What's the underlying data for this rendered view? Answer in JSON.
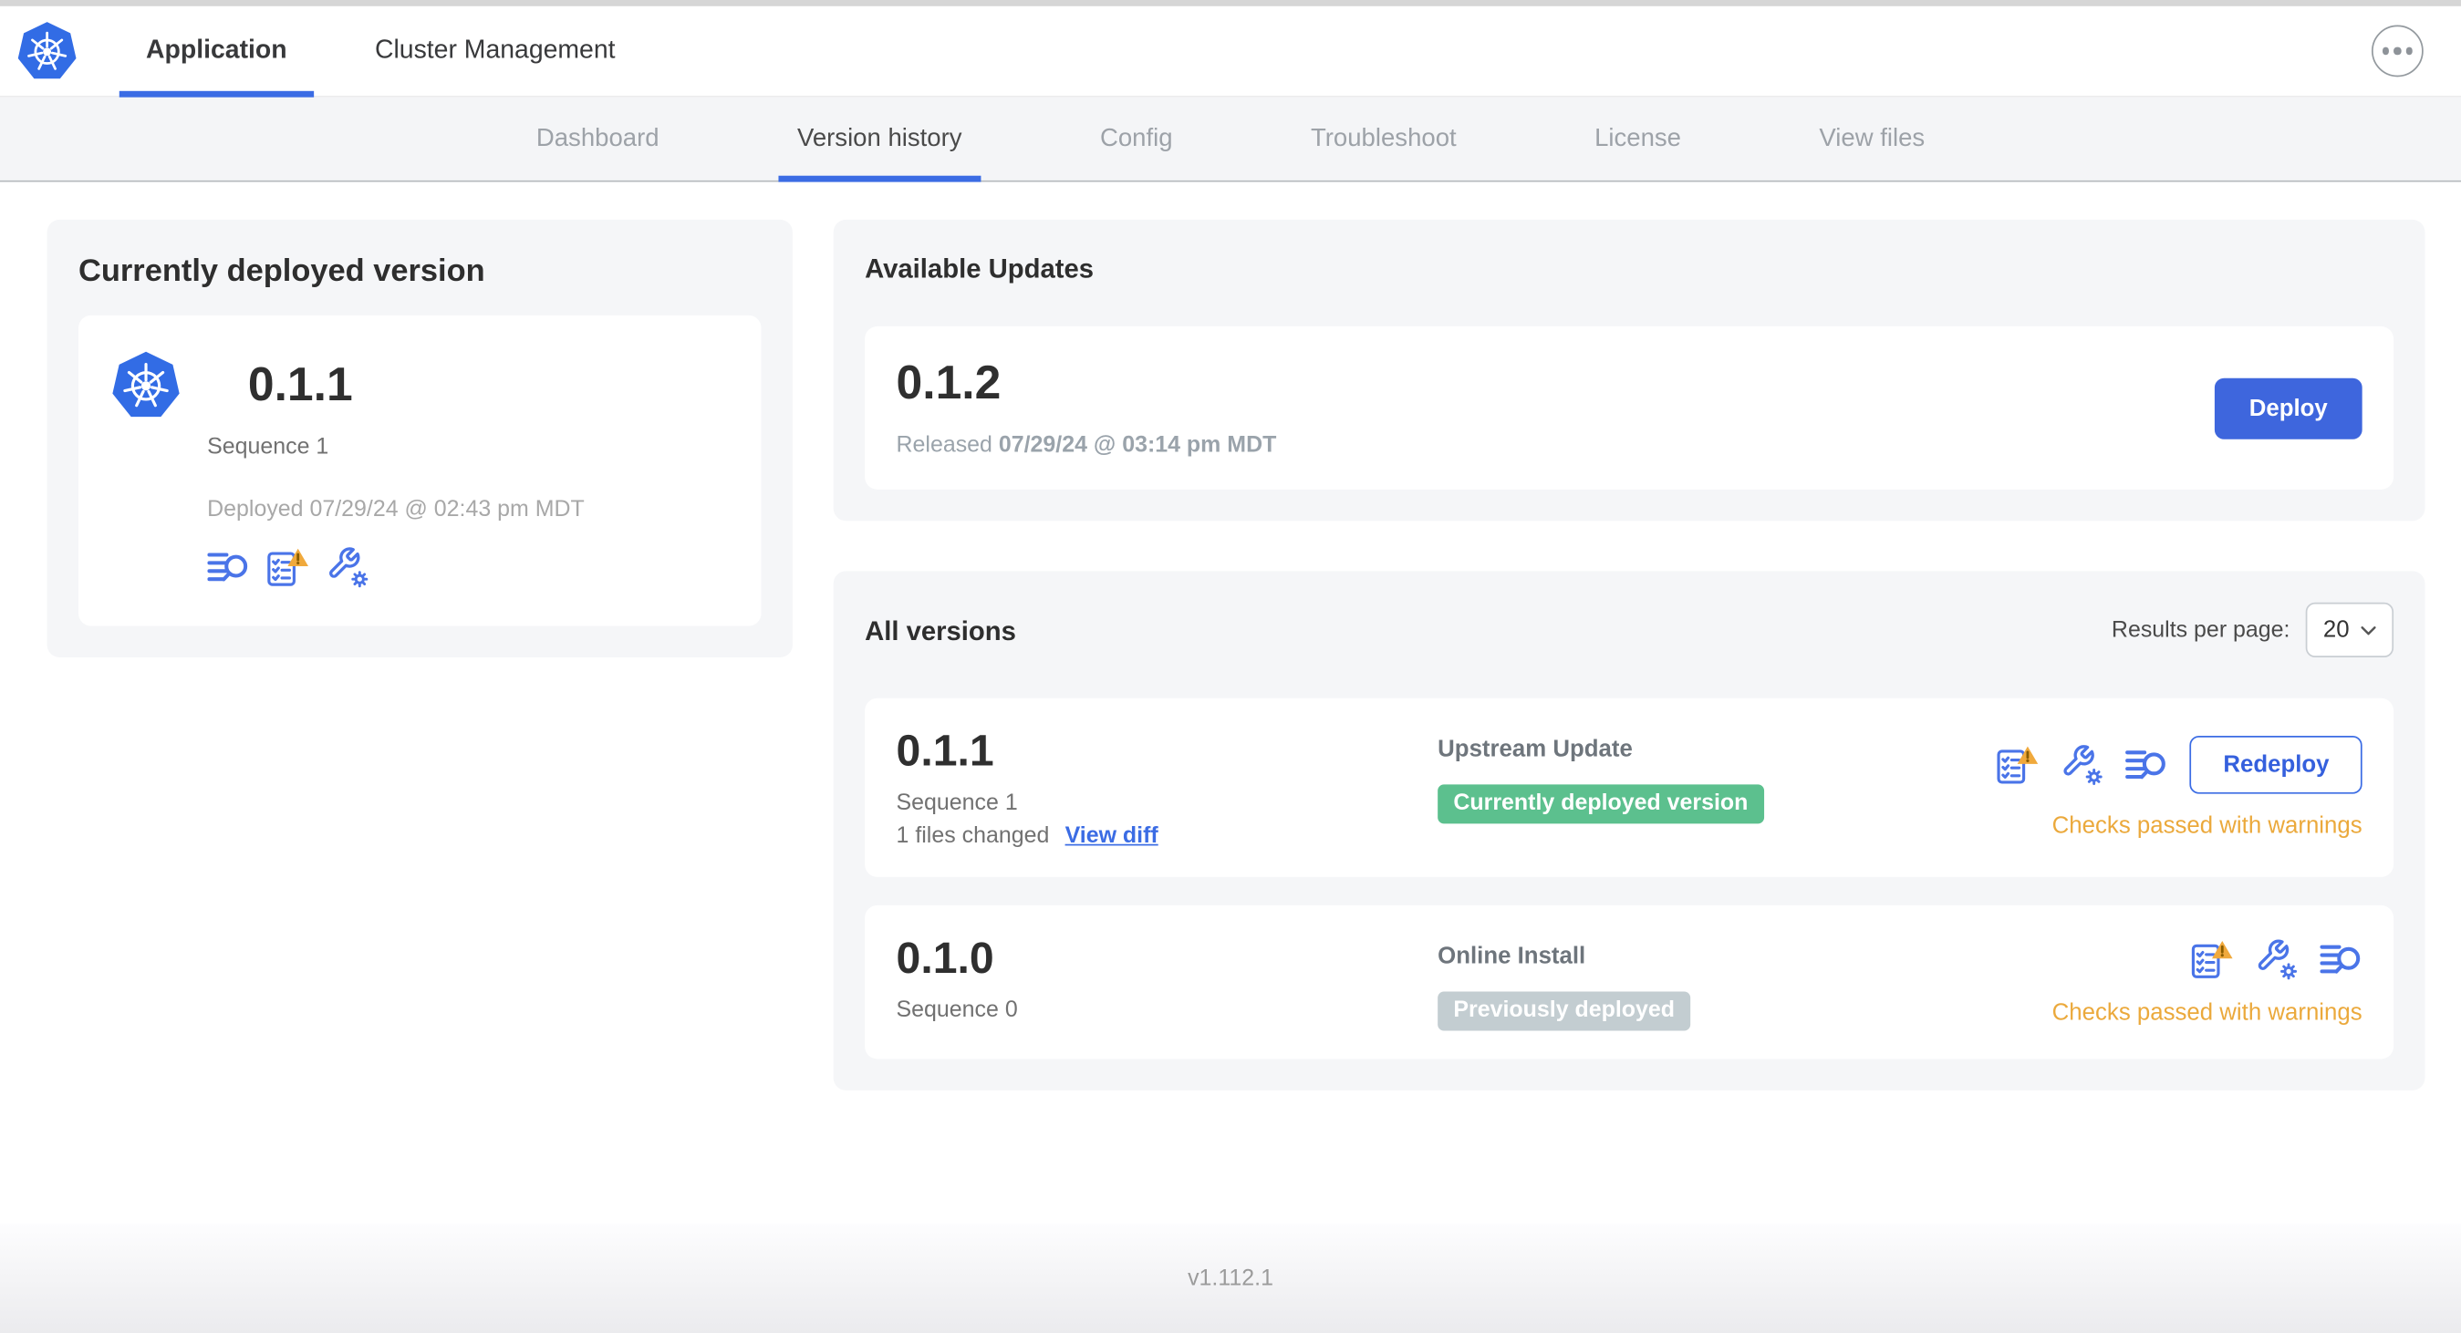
{
  "header": {
    "tabs": [
      {
        "label": "Application",
        "active": true
      },
      {
        "label": "Cluster Management",
        "active": false
      }
    ]
  },
  "subnav": {
    "tabs": [
      {
        "label": "Dashboard",
        "active": false
      },
      {
        "label": "Version history",
        "active": true
      },
      {
        "label": "Config",
        "active": false
      },
      {
        "label": "Troubleshoot",
        "active": false
      },
      {
        "label": "License",
        "active": false
      },
      {
        "label": "View files",
        "active": false
      }
    ]
  },
  "current_version_card": {
    "title": "Currently deployed version",
    "version": "0.1.1",
    "sequence": "Sequence 1",
    "deployed": "Deployed 07/29/24 @ 02:43 pm MDT",
    "icons": [
      "diff-search-icon",
      "checks-warning-icon",
      "wrench-config-icon"
    ]
  },
  "available_updates": {
    "title": "Available Updates",
    "version": "0.1.2",
    "released_label": "Released",
    "released_date": "07/29/24 @ 03:14 pm MDT",
    "deploy_label": "Deploy"
  },
  "all_versions": {
    "title": "All versions",
    "results_per_page_label": "Results per page:",
    "results_per_page_value": "20",
    "rows": [
      {
        "version": "0.1.1",
        "sequence": "Sequence 1",
        "files_changed": "1 files changed",
        "view_diff_label": "View diff",
        "source": "Upstream Update",
        "badge": "Currently deployed version",
        "status": "Checks passed with warnings",
        "action_label": "Redeploy",
        "icons": [
          "checks-warning-icon",
          "wrench-config-icon",
          "diff-search-icon"
        ]
      },
      {
        "version": "0.1.0",
        "sequence": "Sequence 0",
        "source": "Online Install",
        "badge": "Previously deployed",
        "status": "Checks passed with warnings",
        "icons": [
          "checks-warning-icon",
          "wrench-config-icon",
          "diff-search-icon"
        ]
      }
    ]
  },
  "footer": {
    "app_version": "v1.112.1"
  },
  "colors": {
    "accent_blue": "#3e66dd",
    "icon_blue": "#4a74e8",
    "logo_blue": "#326ce5",
    "warning_amber": "#eba93c",
    "badge_green": "#5cc08e",
    "badge_gray": "#c3cdd1",
    "link_blue": "#3b6ce4",
    "subnav_bg": "#f4f5f7",
    "card_bg": "#f5f6f8"
  }
}
